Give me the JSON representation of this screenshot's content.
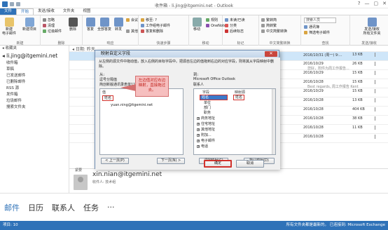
{
  "window": {
    "title": "收件箱 - li.jing@itgemini.net - Outlook",
    "controls": [
      "?",
      "—",
      "▢",
      "✕"
    ]
  },
  "ribbon_tabs": [
    "文件",
    "开始",
    "发送/接收",
    "文件夹",
    "视图"
  ],
  "ribbon": {
    "new_email": "新建\n电子邮件",
    "new_items": "新建项目",
    "ignore": "忽略",
    "cleanup": "清理",
    "junk": "垃圾邮件",
    "delete": "删除",
    "reply": "答复",
    "reply_all": "全部答复",
    "forward": "转发",
    "more": "其他",
    "meeting": "会议",
    "quick_steps": [
      "移至: ?",
      "工作组电子邮件",
      "答复和删除"
    ],
    "move": "移动",
    "rules": "规则",
    "onenote": "OneNote",
    "unread": "未读/已读",
    "categorize": "分类",
    "followup": "后续标志",
    "search_people": "搜索人员",
    "address_book": "通讯簿",
    "filter_email": "筛选电子邮件",
    "send_receive_all": "发送/接收\n所有文件夹",
    "chinese_conv": [
      "繁转简",
      "简转繁",
      "中文简繁转换"
    ],
    "groups": [
      "新建",
      "删除",
      "响应",
      "快速步骤",
      "移动",
      "标记",
      "中文简繁转换",
      "查找",
      "发送/接收"
    ]
  },
  "left_pane": {
    "favorites": "◂ 收藏夹",
    "account": "◂ li.jing@itgemini.net",
    "folders": [
      "收件箱",
      "草稿",
      "已发送邮件",
      "已删除邮件",
      "RSS 源",
      "发件箱",
      "垃圾邮件",
      "搜索文件夹"
    ]
  },
  "mail_list": {
    "header": "◂ 日期: 昨天",
    "rows": [
      {
        "date": "2016/10/31 (周一) 9:...",
        "size": "13 KB",
        "preview": ""
      },
      {
        "date": "2016/10/29",
        "size": "26 KB",
        "preview": "您好，附件为周工作报告..."
      },
      {
        "date": "2016/10/29",
        "size": "15 KB",
        "preview": ""
      },
      {
        "date": "2016/10/28",
        "size": "15 KB",
        "preview": "Best regards, 周工作报告 Kent"
      },
      {
        "date": "2016/10/29",
        "size": "15 KB",
        "preview": ""
      },
      {
        "date": "2016/10/28",
        "size": "13 KB",
        "preview": ""
      },
      {
        "date": "2016/10/28",
        "size": "404 KB",
        "preview": ""
      },
      {
        "date": "2016/10/28",
        "size": "38 KB",
        "preview": ""
      },
      {
        "date": "2016/10/28",
        "size": "11 KB",
        "preview": ""
      },
      {
        "date": "2016/10/28",
        "size": "",
        "preview": ""
      }
    ]
  },
  "reading": {
    "label": "紧要",
    "sender": "xin.nian@itgemini.net",
    "recipients": "收件人: 技术组"
  },
  "bottom_nav": [
    "邮件",
    "日历",
    "联系人",
    "任务",
    "···"
  ],
  "status": {
    "left": "项目: 10",
    "right": "所有文件夹都是最新的。  已连接到: Microsoft Exchange"
  },
  "dialog": {
    "title": "映射自定义字段",
    "close": "✕",
    "instruction": "从左侧的源文件中拖动值，放入右侧的目标字段中。把源自左边的值拖到右边的对应字段，则将其从字段映射中删除。",
    "from_label": "从:",
    "from_type": "逗号分隔值",
    "from_file": "简创新版通讯录表单11 ...",
    "to_label": "到:",
    "to_type": "Microsoft Office Outlook",
    "to_folder": "联系人",
    "left_col": "值",
    "right_cols": [
      "字段",
      "映射源"
    ],
    "left_values": [
      "姓名",
      "yuan.ning@itgemini.net"
    ],
    "right_fields": [
      {
        "name": "姓名",
        "mapped": "姓名",
        "expand": true,
        "highlight": true
      },
      {
        "name": "单位",
        "mapped": "",
        "expand": false
      },
      {
        "name": "部门",
        "mapped": "",
        "expand": false
      },
      {
        "name": "职务",
        "mapped": "",
        "expand": false
      },
      {
        "name": "商务地址",
        "mapped": "",
        "expand": true
      },
      {
        "name": "住宅地址",
        "mapped": "",
        "expand": true
      },
      {
        "name": "其他地址",
        "mapped": "",
        "expand": true
      },
      {
        "name": "附加...",
        "mapped": "",
        "expand": true
      },
      {
        "name": "电子邮件",
        "mapped": "",
        "expand": true
      },
      {
        "name": "电话",
        "mapped": "",
        "expand": true
      }
    ],
    "highlight_text": "姓名",
    "callout": "左边值对应右边映射，直接拖过去。",
    "btn_prev": "< 上一页(P)",
    "btn_next": "下一页(N) >",
    "btn_clear": "清除映射(C)",
    "btn_default": "默认映射(D)",
    "btn_ok": "确定",
    "btn_cancel": "取消"
  },
  "colors": {
    "accent": "#2f72b8",
    "callout": "#f6bfbf",
    "highlight_red": "#d1322c"
  }
}
